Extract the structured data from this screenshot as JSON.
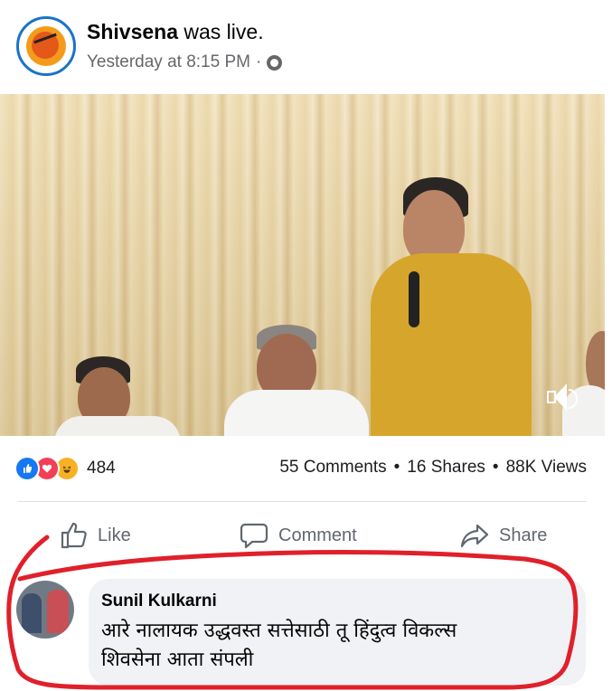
{
  "post": {
    "page_name": "Shivsena",
    "action_text": " was live.",
    "time": "Yesterday at 8:15 PM",
    "separator": "·",
    "privacy_icon": "globe-icon"
  },
  "video": {
    "sound_icon": "speaker-icon"
  },
  "stats": {
    "reaction_icons": [
      "like-reaction-icon",
      "love-reaction-icon",
      "haha-reaction-icon"
    ],
    "reaction_count": "484",
    "comments": "55 Comments",
    "shares": "16 Shares",
    "views": "88K Views",
    "dot": "•"
  },
  "actions": {
    "like": "Like",
    "comment": "Comment",
    "share": "Share"
  },
  "comment": {
    "author": "Sunil Kulkarni",
    "line1": "आरे नालायक उद्धवस्त सत्तेसाठी तू हिंदुत्व विकल्स",
    "line2": "शिवसेना आता संपली"
  },
  "colors": {
    "facebook_blue": "#1877f2",
    "annotation_red": "#e0202a",
    "meta_gray": "#65676b"
  }
}
